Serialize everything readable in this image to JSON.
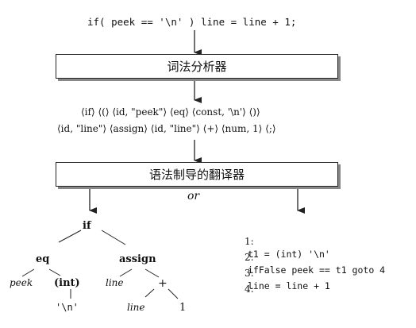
{
  "source_statement": "if( peek == '\\n' ) line = line + 1;",
  "lexer_label": "词法分析器",
  "token_line_1": "⟨if⟩ ⟨(⟩ ⟨id, \"peek\"⟩ ⟨eq⟩ ⟨const, '\\n'⟩ ⟨)⟩",
  "token_line_2": "⟨id, \"line\"⟩ ⟨assign⟩ ⟨id, \"line\"⟩ ⟨+⟩ ⟨num, 1⟩ ⟨;⟩",
  "translator_label": "语法制导的翻译器",
  "or_label": "or",
  "tree": {
    "root": "if",
    "eq": "eq",
    "assign": "assign",
    "peek": "peek",
    "int": "(int)",
    "newline_char": "'\\n'",
    "line_left": "line",
    "plus": "+",
    "line_right": "line",
    "one": "1"
  },
  "code_lines": [
    {
      "num": "1:",
      "text": "t1 = (int) '\\n'"
    },
    {
      "num": "2:",
      "text": "ifFalse peek == t1 goto 4"
    },
    {
      "num": "3:",
      "text": "line = line + 1"
    },
    {
      "num": "4:",
      "text": ""
    }
  ]
}
